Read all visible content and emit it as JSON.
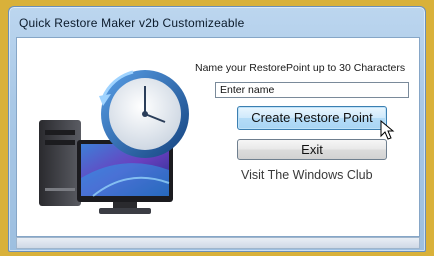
{
  "window": {
    "title": "Quick Restore Maker v2b  Customizeable"
  },
  "form": {
    "prompt": "Name your RestorePoint up to 30  Characters",
    "name_value": "Enter name",
    "create_label": "Create Restore Point",
    "exit_label": "Exit",
    "link_label": "Visit The Windows Club"
  },
  "icons": {
    "logo": "computer-with-clock-icon",
    "cursor": "mouse-pointer-icon"
  },
  "colors": {
    "desktop": "#d9b13a",
    "create_button_accent": "#3c7fb1"
  }
}
